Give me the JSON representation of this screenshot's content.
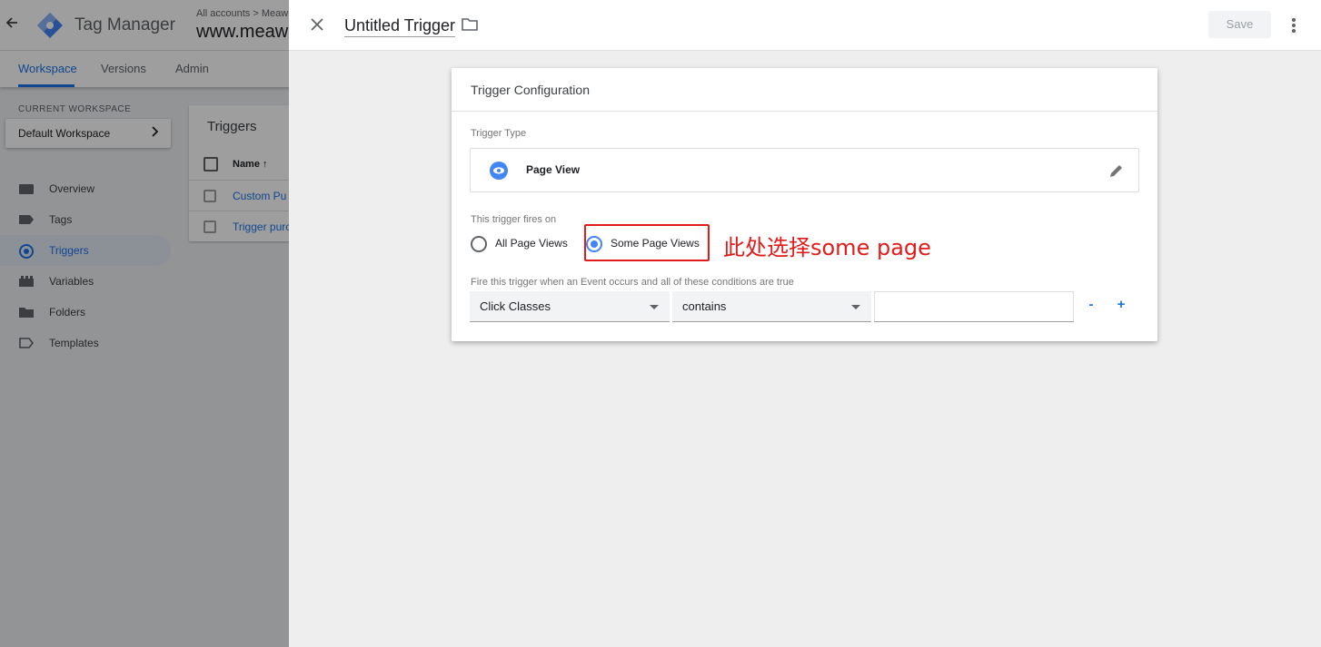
{
  "background_app": {
    "app_title": "Tag Manager",
    "breadcrumb": "All accounts > Meaw",
    "account_name": "www.meaw",
    "tabs": [
      {
        "label": "Workspace"
      },
      {
        "label": "Versions"
      },
      {
        "label": "Admin"
      }
    ],
    "workspace": {
      "section_label": "CURRENT WORKSPACE",
      "name": "Default Workspace"
    },
    "sidebar": {
      "items": [
        {
          "label": "Overview"
        },
        {
          "label": "Tags"
        },
        {
          "label": "Triggers"
        },
        {
          "label": "Variables"
        },
        {
          "label": "Folders"
        },
        {
          "label": "Templates"
        }
      ]
    },
    "triggers_list": {
      "title": "Triggers",
      "column_name": "Name",
      "sort_indicator": "↑",
      "rows": [
        {
          "name": "Custom Pu"
        },
        {
          "name": "Trigger purc"
        }
      ]
    }
  },
  "panel": {
    "trigger_name": "Untitled Trigger",
    "save_label": "Save",
    "config": {
      "title": "Trigger Configuration",
      "type_label": "Trigger Type",
      "type_value": "Page View",
      "fires_on_label": "This trigger fires on",
      "radio_all": "All Page Views",
      "radio_some": "Some Page Views",
      "selected_radio": "Some Page Views",
      "condition_label": "Fire this trigger when an Event occurs and all of these conditions are true",
      "condition": {
        "variable": "Click Classes",
        "operator": "contains",
        "value": ""
      },
      "minus_label": "-",
      "plus_label": "+"
    },
    "annotation_text": "此处选择some page"
  },
  "colors": {
    "accent": "#1a73e8",
    "annotation_red": "#e21b1b",
    "eye_blue": "#4285f4"
  }
}
